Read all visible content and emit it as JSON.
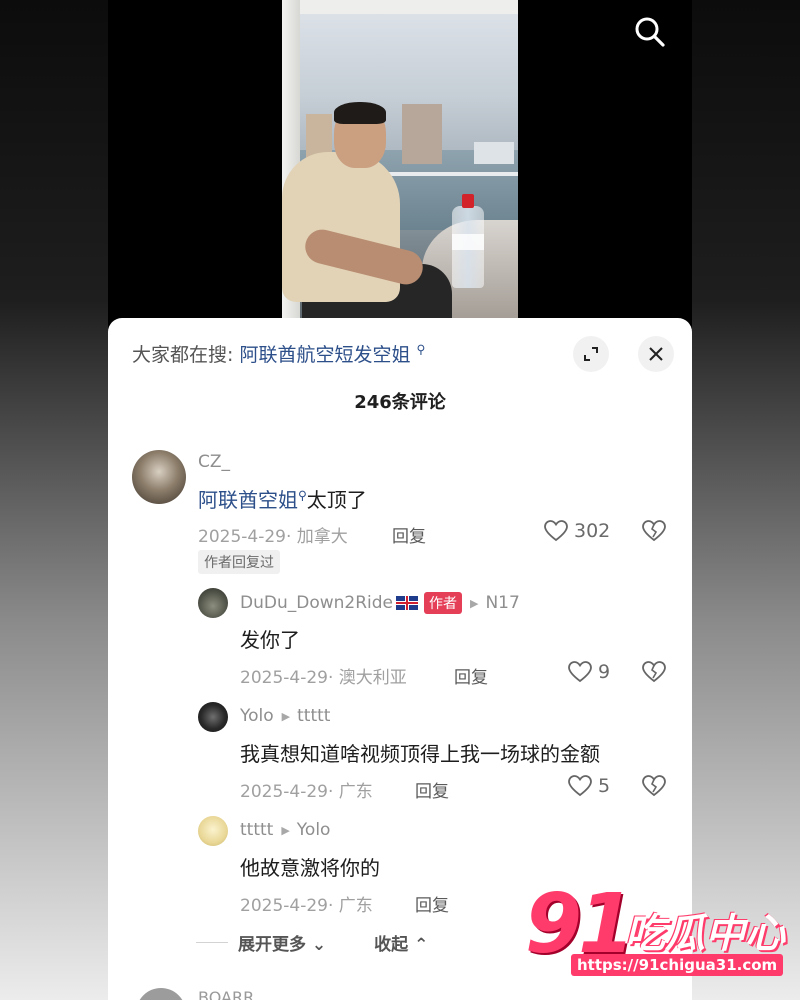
{
  "hot_search": {
    "prefix": "大家都在搜:",
    "query": "阿联酋航空短发空姐"
  },
  "comment_count_label": "246条评论",
  "comments": [
    {
      "user": "CZ_",
      "body_link": "阿联酋空姐",
      "body_rest": "太顶了",
      "date": "2025-4-29",
      "location": "· 加拿大",
      "reply_label": "回复",
      "likes": "302",
      "tag": "作者回复过"
    },
    {
      "user": "DuDu_Down2Ride",
      "badge": "作者",
      "reply_to": "N17",
      "body": "发你了",
      "date": "2025-4-29",
      "location": "· 澳大利亚",
      "reply_label": "回复",
      "likes": "9"
    },
    {
      "user": "Yolo",
      "reply_to": "ttttt",
      "body": "我真想知道啥视频顶得上我一场球的金额",
      "date": "2025-4-29",
      "location": "· 广东",
      "reply_label": "回复",
      "likes": "5"
    },
    {
      "user": "ttttt",
      "reply_to": "Yolo",
      "body": "他故意激将你的",
      "date": "2025-4-29",
      "location": "· 广东",
      "reply_label": "回复"
    }
  ],
  "expand_more_label": "展开更多",
  "collapse_label": "收起",
  "next_user_peek": "BOARR",
  "watermark": {
    "number": "91",
    "title": "吃瓜中心",
    "url": "https://91chigua31.com"
  },
  "colors": {
    "link": "#2c4f8a",
    "author_badge": "#e53e57",
    "watermark": "#ff3b6b"
  }
}
